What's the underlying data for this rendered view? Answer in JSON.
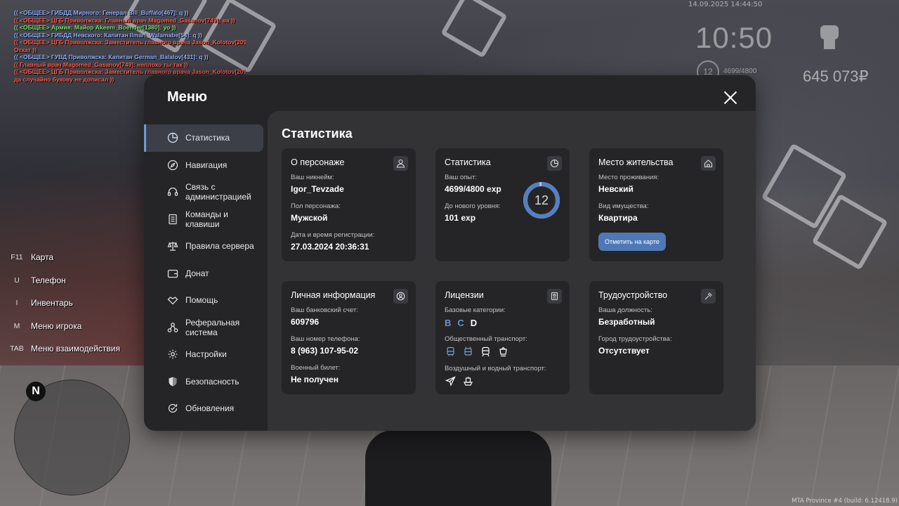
{
  "chat": [
    {
      "text": "(( <ОБЩЕЕ> ГИБДД Мирного: Генерал Bill_Buffalo[467]: q ))",
      "color": "#8fb0ff"
    },
    {
      "text": "(( <ОБЩЕЕ> ЦГБ Приволжска: Главный врач Magomed_Gasanov[749]: ва ))",
      "color": "#ff5a4a"
    },
    {
      "text": "(( <ОБЩЕЕ> Армия: Майор Akeem_Boender[1380]: уо ))",
      "color": "#7adf6a"
    },
    {
      "text": "(( <ОБЩЕЕ> ГИБДД Невского: Капитан Ilmari_Walamabe[54]: q ))",
      "color": "#8fb0ff"
    },
    {
      "text": "(( <ОБЩЕЕ> ЦГБ Приволжска: Заместитель главного врача Jason_Kolotov[209]:",
      "color": "#ff5a4a"
    },
    {
      "text": "Откат ))",
      "color": "#ff5a4a"
    },
    {
      "text": "(( <ОБЩЕЕ> ГУВД Приволжска: Капитан German_Balalov[431]: q ))",
      "color": "#8fb0ff"
    },
    {
      "text": "(( Главный врач Magomed_Gasanov[749]: неплохо ты так ))",
      "color": "#ff5a4a"
    },
    {
      "text": "(( <ОБЩЕЕ> ЦГБ Приволжска: Заместитель главного врача Jason_Kolotov[209]:",
      "color": "#ff5a4a"
    },
    {
      "text": "да случайно букову не дописал ))",
      "color": "#ff5a4a"
    }
  ],
  "hud": {
    "date": "14.09.2025 14:44:50",
    "time": "10:50",
    "level": "12",
    "exp": "4699/4800",
    "money": "645 073₽"
  },
  "hotkeys": [
    {
      "key": "F11",
      "label": "Карта"
    },
    {
      "key": "U",
      "label": "Телефон"
    },
    {
      "key": "I",
      "label": "Инвентарь"
    },
    {
      "key": "M",
      "label": "Меню игрока"
    },
    {
      "key": "TAB",
      "label": "Меню взаимодействия"
    }
  ],
  "minimap": {
    "north": "N"
  },
  "build": "MTA Province #4 (build: 6.12418.9)",
  "menu": {
    "title": "Меню",
    "sidebar": [
      {
        "label": "Статистика",
        "icon": "pie-chart-icon",
        "active": true
      },
      {
        "label": "Навигация",
        "icon": "compass-icon",
        "active": false
      },
      {
        "label": "Связь с администрацией",
        "icon": "headset-icon",
        "active": false
      },
      {
        "label": "Команды и клавиши",
        "icon": "document-icon",
        "active": false
      },
      {
        "label": "Правила сервера",
        "icon": "scales-icon",
        "active": false
      },
      {
        "label": "Донат",
        "icon": "wallet-icon",
        "active": false
      },
      {
        "label": "Помощь",
        "icon": "handshake-icon",
        "active": false
      },
      {
        "label": "Реферальная система",
        "icon": "referral-icon",
        "active": false
      },
      {
        "label": "Настройки",
        "icon": "gear-icon",
        "active": false
      },
      {
        "label": "Безопасность",
        "icon": "shield-icon",
        "active": false
      },
      {
        "label": "Обновления",
        "icon": "refresh-check-icon",
        "active": false
      }
    ],
    "content_title": "Статистика",
    "cards": {
      "character": {
        "title": "О персонаже",
        "nickname_label": "Ваш никнейм:",
        "nickname": "Igor_Tevzade",
        "gender_label": "Пол персонажа:",
        "gender": "Мужской",
        "reg_label": "Дата и время регистрации:",
        "reg": "27.03.2024 20:36:31"
      },
      "stats": {
        "title": "Статистика",
        "exp_label": "Ваш опыт:",
        "exp": "4699/4800 exp",
        "next_label": "До нового уровня:",
        "next": "101 exp",
        "level": "12",
        "level_progress": 0.979
      },
      "residence": {
        "title": "Место жительства",
        "place_label": "Место проживания:",
        "place": "Невский",
        "property_label": "Вид имущества:",
        "property": "Квартира",
        "map_button": "Отметить на карте"
      },
      "personal": {
        "title": "Личная информация",
        "bank_label": "Ваш банковский счет:",
        "bank": "609796",
        "phone_label": "Ваш номер телефона:",
        "phone": "8 (963) 107-95-02",
        "military_label": "Военный билет:",
        "military": "Не получен"
      },
      "licenses": {
        "title": "Лицензии",
        "base_label": "Базовые категории:",
        "categories": [
          {
            "name": "B",
            "owned": true
          },
          {
            "name": "C",
            "owned": true
          },
          {
            "name": "D",
            "owned": false
          }
        ],
        "public_label": "Общественный транспорт:",
        "public_icons": [
          "bus-icon",
          "trolleybus-icon",
          "train-icon",
          "tram-icon"
        ],
        "air_label": "Воздушный и водный транспорт:",
        "air_icons": [
          "plane-icon",
          "ship-icon"
        ]
      },
      "job": {
        "title": "Трудоустройство",
        "position_label": "Ваша должность:",
        "position": "Безработный",
        "city_label": "Город трудоустройства:",
        "city": "Отсутствует"
      }
    }
  },
  "colors": {
    "accent": "#4f78b6",
    "accent_light": "#6a92cf",
    "panel": "#252527",
    "content": "#333336"
  }
}
